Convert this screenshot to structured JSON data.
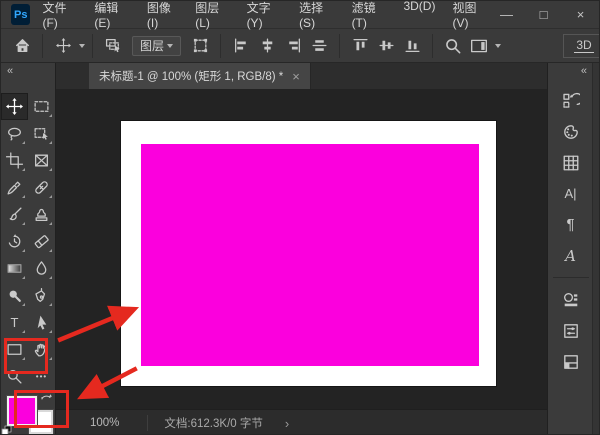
{
  "window": {
    "app_label": "Ps",
    "menus": [
      "文件(F)",
      "编辑(E)",
      "图像(I)",
      "图层(L)",
      "文字(Y)",
      "选择(S)",
      "滤镜(T)",
      "3D(D)",
      "视图(V)"
    ],
    "minimize": "—",
    "maximize": "□",
    "close": "×"
  },
  "options_bar": {
    "layer_target_label": "图层",
    "threed_label": "3D"
  },
  "toolbar": {
    "collapse_glyph": "«",
    "type_tool_glyph": "T",
    "more_glyph": "•••"
  },
  "tabbar": {
    "title": "未标题-1 @ 100% (矩形 1, RGB/8) *",
    "close_glyph": "×"
  },
  "panels": {
    "collapse_glyph": "«",
    "character_glyph": "A|",
    "paragraph_glyph": "¶",
    "glyphs_glyph": "A"
  },
  "statusbar": {
    "zoom_level": "100%",
    "document_info": "文档:612.3K/0 字节",
    "chevron": "›"
  },
  "colors": {
    "foreground": "#fb00dd",
    "annotation": "#e5291f",
    "ps_logo_bg": "#001e36",
    "ps_logo_text": "#31a8ff",
    "pasteboard": "#232323"
  }
}
